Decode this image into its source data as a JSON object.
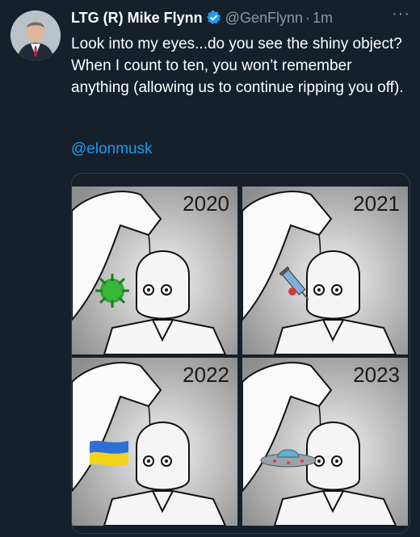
{
  "tweet": {
    "display_name": "LTG (R) Mike Flynn",
    "handle": "@GenFlynn",
    "separator": "·",
    "time": "1m",
    "more_label": "···",
    "text": "Look into my eyes...do you see the shiny object? When I count to ten, you won’t remember anything (allowing us to continue ripping you off).",
    "mention": "@elonmusk"
  },
  "media": {
    "panels": [
      {
        "year": "2020",
        "object_icon": "virus-icon"
      },
      {
        "year": "2021",
        "object_icon": "syringe-icon"
      },
      {
        "year": "2022",
        "object_icon": "ukraine-flag-icon"
      },
      {
        "year": "2023",
        "object_icon": "ufo-icon"
      }
    ]
  },
  "colors": {
    "background": "#15202b",
    "link": "#1d9bf0",
    "secondary_text": "#8b98a5",
    "verified": "#1d9bf0"
  }
}
